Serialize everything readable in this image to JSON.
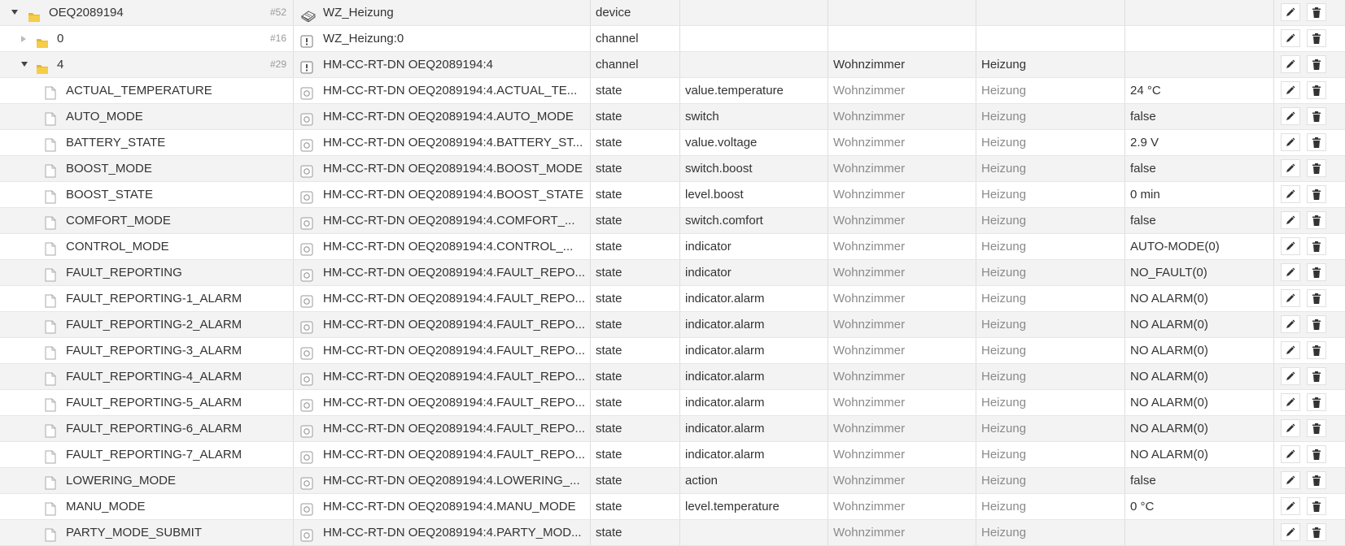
{
  "rows": [
    {
      "kind": "device",
      "indent": 0,
      "expand": "down",
      "icon": "folder-icon",
      "name": "OEQ2089194",
      "id": "#52",
      "obj_icon": "device-icon",
      "obj": "WZ_Heizung",
      "type": "device",
      "role": "",
      "room": "",
      "func": "",
      "value": ""
    },
    {
      "kind": "channel",
      "indent": 1,
      "expand": "right",
      "icon": "folder-icon",
      "name": "0",
      "id": "#16",
      "obj_icon": "channel-icon",
      "obj": "WZ_Heizung:0",
      "type": "channel",
      "role": "",
      "room": "",
      "func": "",
      "value": ""
    },
    {
      "kind": "channel",
      "indent": 1,
      "expand": "down",
      "icon": "folder-icon",
      "name": "4",
      "id": "#29",
      "obj_icon": "channel-icon",
      "obj": "HM-CC-RT-DN OEQ2089194:4",
      "type": "channel",
      "role": "",
      "room": "Wohnzimmer",
      "func": "Heizung",
      "value": ""
    },
    {
      "kind": "state",
      "name": "ACTUAL_TEMPERATURE",
      "obj": "HM-CC-RT-DN OEQ2089194:4.ACTUAL_TE...",
      "type": "state",
      "role": "value.temperature",
      "room": "Wohnzimmer",
      "func": "Heizung",
      "value": "24 °C"
    },
    {
      "kind": "state",
      "name": "AUTO_MODE",
      "obj": "HM-CC-RT-DN OEQ2089194:4.AUTO_MODE",
      "type": "state",
      "role": "switch",
      "room": "Wohnzimmer",
      "func": "Heizung",
      "value": "false"
    },
    {
      "kind": "state",
      "name": "BATTERY_STATE",
      "obj": "HM-CC-RT-DN OEQ2089194:4.BATTERY_ST...",
      "type": "state",
      "role": "value.voltage",
      "room": "Wohnzimmer",
      "func": "Heizung",
      "value": "2.9 V"
    },
    {
      "kind": "state",
      "name": "BOOST_MODE",
      "obj": "HM-CC-RT-DN OEQ2089194:4.BOOST_MODE",
      "type": "state",
      "role": "switch.boost",
      "room": "Wohnzimmer",
      "func": "Heizung",
      "value": "false"
    },
    {
      "kind": "state",
      "name": "BOOST_STATE",
      "obj": "HM-CC-RT-DN OEQ2089194:4.BOOST_STATE",
      "type": "state",
      "role": "level.boost",
      "room": "Wohnzimmer",
      "func": "Heizung",
      "value": "0 min"
    },
    {
      "kind": "state",
      "name": "COMFORT_MODE",
      "obj": "HM-CC-RT-DN OEQ2089194:4.COMFORT_...",
      "type": "state",
      "role": "switch.comfort",
      "room": "Wohnzimmer",
      "func": "Heizung",
      "value": "false"
    },
    {
      "kind": "state",
      "name": "CONTROL_MODE",
      "obj": "HM-CC-RT-DN OEQ2089194:4.CONTROL_...",
      "type": "state",
      "role": "indicator",
      "room": "Wohnzimmer",
      "func": "Heizung",
      "value": "AUTO-MODE(0)"
    },
    {
      "kind": "state",
      "name": "FAULT_REPORTING",
      "obj": "HM-CC-RT-DN OEQ2089194:4.FAULT_REPO...",
      "type": "state",
      "role": "indicator",
      "room": "Wohnzimmer",
      "func": "Heizung",
      "value": "NO_FAULT(0)"
    },
    {
      "kind": "state",
      "name": "FAULT_REPORTING-1_ALARM",
      "obj": "HM-CC-RT-DN OEQ2089194:4.FAULT_REPO...",
      "type": "state",
      "role": "indicator.alarm",
      "room": "Wohnzimmer",
      "func": "Heizung",
      "value": "NO ALARM(0)"
    },
    {
      "kind": "state",
      "name": "FAULT_REPORTING-2_ALARM",
      "obj": "HM-CC-RT-DN OEQ2089194:4.FAULT_REPO...",
      "type": "state",
      "role": "indicator.alarm",
      "room": "Wohnzimmer",
      "func": "Heizung",
      "value": "NO ALARM(0)"
    },
    {
      "kind": "state",
      "name": "FAULT_REPORTING-3_ALARM",
      "obj": "HM-CC-RT-DN OEQ2089194:4.FAULT_REPO...",
      "type": "state",
      "role": "indicator.alarm",
      "room": "Wohnzimmer",
      "func": "Heizung",
      "value": "NO ALARM(0)"
    },
    {
      "kind": "state",
      "name": "FAULT_REPORTING-4_ALARM",
      "obj": "HM-CC-RT-DN OEQ2089194:4.FAULT_REPO...",
      "type": "state",
      "role": "indicator.alarm",
      "room": "Wohnzimmer",
      "func": "Heizung",
      "value": "NO ALARM(0)"
    },
    {
      "kind": "state",
      "name": "FAULT_REPORTING-5_ALARM",
      "obj": "HM-CC-RT-DN OEQ2089194:4.FAULT_REPO...",
      "type": "state",
      "role": "indicator.alarm",
      "room": "Wohnzimmer",
      "func": "Heizung",
      "value": "NO ALARM(0)"
    },
    {
      "kind": "state",
      "name": "FAULT_REPORTING-6_ALARM",
      "obj": "HM-CC-RT-DN OEQ2089194:4.FAULT_REPO...",
      "type": "state",
      "role": "indicator.alarm",
      "room": "Wohnzimmer",
      "func": "Heizung",
      "value": "NO ALARM(0)"
    },
    {
      "kind": "state",
      "name": "FAULT_REPORTING-7_ALARM",
      "obj": "HM-CC-RT-DN OEQ2089194:4.FAULT_REPO...",
      "type": "state",
      "role": "indicator.alarm",
      "room": "Wohnzimmer",
      "func": "Heizung",
      "value": "NO ALARM(0)"
    },
    {
      "kind": "state",
      "name": "LOWERING_MODE",
      "obj": "HM-CC-RT-DN OEQ2089194:4.LOWERING_...",
      "type": "state",
      "role": "action",
      "room": "Wohnzimmer",
      "func": "Heizung",
      "value": "false"
    },
    {
      "kind": "state",
      "name": "MANU_MODE",
      "obj": "HM-CC-RT-DN OEQ2089194:4.MANU_MODE",
      "type": "state",
      "role": "level.temperature",
      "room": "Wohnzimmer",
      "func": "Heizung",
      "value": "0 °C"
    },
    {
      "kind": "state",
      "name": "PARTY_MODE_SUBMIT",
      "obj": "HM-CC-RT-DN OEQ2089194:4.PARTY_MOD...",
      "type": "state",
      "role": "",
      "room": "Wohnzimmer",
      "func": "Heizung",
      "value": ""
    }
  ]
}
